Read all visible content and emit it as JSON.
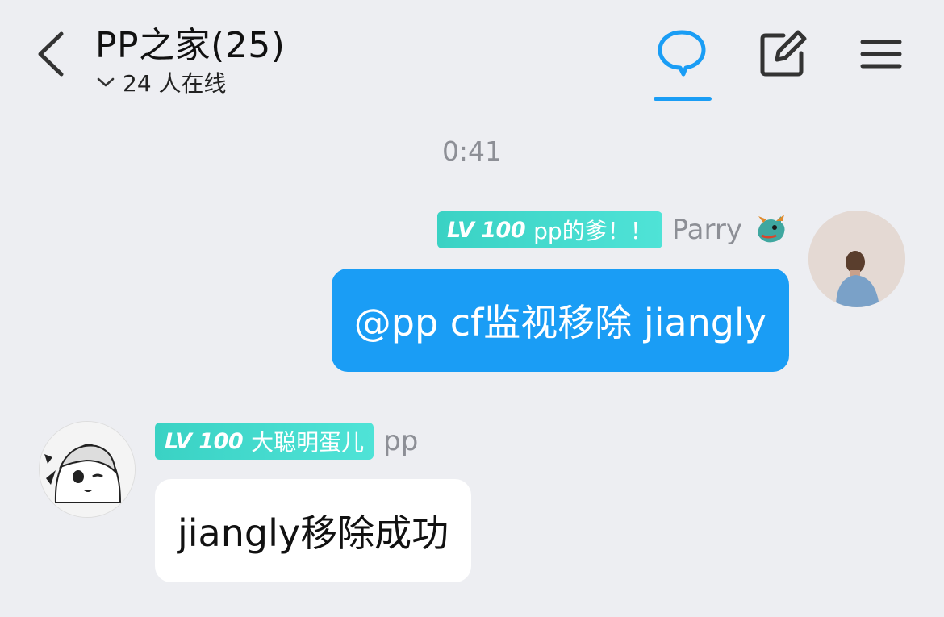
{
  "header": {
    "title": "PP之家(25)",
    "online": "24 人在线"
  },
  "time": "0:41",
  "messages": [
    {
      "sender": "Parry",
      "level": "LV 100",
      "badge_title": "pp的爹！！",
      "text": "@pp cf监视移除 jiangly"
    },
    {
      "sender": "pp",
      "level": "LV 100",
      "badge_title": "大聪明蛋儿",
      "text": "jiangly移除成功"
    }
  ],
  "colors": {
    "accent": "#1a9df5",
    "badge": "#3ad2c4",
    "background": "#edeef2"
  },
  "icons": [
    "back-arrow-icon",
    "chevron-down-icon",
    "chat-bubble-icon",
    "edit-icon",
    "menu-icon",
    "dragon-icon"
  ]
}
